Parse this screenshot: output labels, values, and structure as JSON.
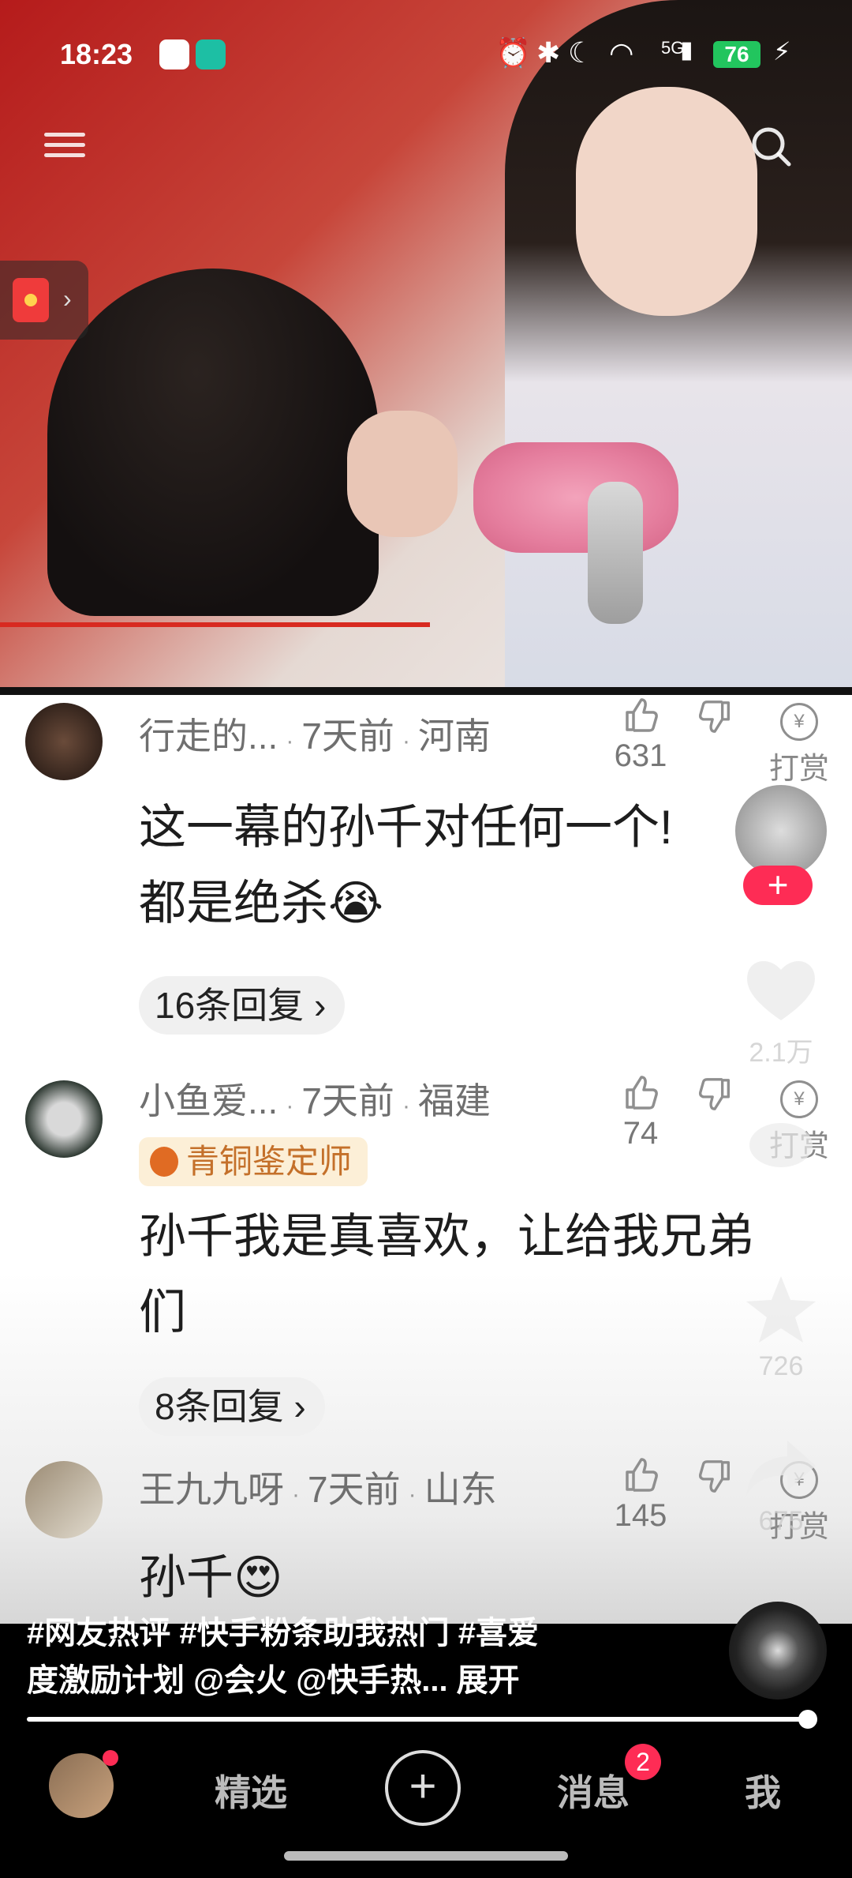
{
  "status_bar": {
    "time": "18:23",
    "battery": "76",
    "network": "5G"
  },
  "comments": [
    {
      "username": "行走的...",
      "time": "7天前",
      "location": "河南",
      "text": "这一幕的孙千对任何一个!",
      "text2": "都是绝杀😭",
      "likes": "631",
      "reward_label": "打赏",
      "replies": "16条回复"
    },
    {
      "username": "小鱼爱...",
      "time": "7天前",
      "location": "福建",
      "badge": "青铜鉴定师",
      "text": "孙千我是真喜欢，让给我兄弟",
      "text2": "们",
      "likes": "74",
      "reward_label": "打赏",
      "replies": "8条回复"
    },
    {
      "username": "王九九呀",
      "time": "7天前",
      "location": "山东",
      "text": "孙千😍",
      "likes": "145",
      "reward_label": "打赏"
    }
  ],
  "side_actions": {
    "likes": "2.1万",
    "stars": "726",
    "shares": "675"
  },
  "caption": {
    "line1": "#网友热评 #快手粉条助我热门 #喜爱",
    "line2": "度激励计划 @会火 @快手热... 展开"
  },
  "nav": {
    "featured": "精选",
    "messages": "消息",
    "messages_badge": "2",
    "me": "我"
  },
  "colors": {
    "accent": "#fe2c55",
    "badge_bg": "#fcefd7",
    "badge_text": "#c4702a"
  }
}
